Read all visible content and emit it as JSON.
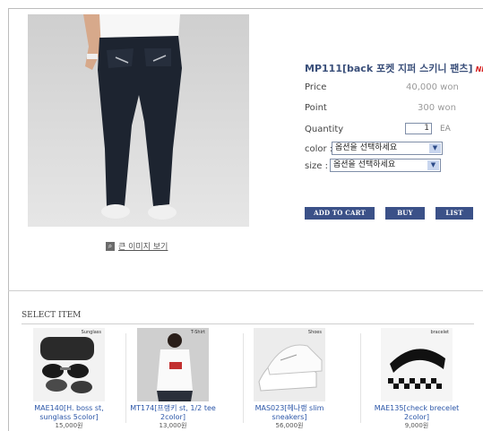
{
  "product": {
    "title": "MP111[back 포켓 지퍼 스키니 팬츠]",
    "new_badge": "NE",
    "zoom_label": "큰 이미지 보기",
    "price_label": "Price",
    "price_value": "40,000 won",
    "point_label": "Point",
    "point_value": "300 won",
    "quantity_label": "Quantity",
    "quantity_value": "1",
    "quantity_unit": "EA",
    "color_label": "color :",
    "color_selected": "옵션을 선택하세요",
    "size_label": "size :",
    "size_selected": "옵션을 선택하세요",
    "buttons": {
      "add_to_cart": "ADD TO CART",
      "buy": "BUY",
      "list": "LIST"
    }
  },
  "select_item": {
    "title": "SELECT ITEM",
    "items": [
      {
        "tag": "Sunglass",
        "name_line1": "MAE140[H. boss st,",
        "name_line2": "sunglass 5color]",
        "price": "15,000원"
      },
      {
        "tag": "T-Shirt",
        "name_line1": "MT174[프랭키 st, 1/2 tee",
        "name_line2": "2color]",
        "price": "13,000원"
      },
      {
        "tag": "Shoes",
        "name_line1": "MAS023[헤나랭 slim",
        "name_line2": "sneakers]",
        "price": "56,000원"
      },
      {
        "tag": "bracelet",
        "name_line1": "MAE135[check brecelet",
        "name_line2": "2color]",
        "price": "9,000원"
      }
    ]
  },
  "colors": {
    "accent": "#3b5188",
    "title": "#3a4f7a",
    "link": "#2b56a8",
    "new": "#d62020"
  }
}
